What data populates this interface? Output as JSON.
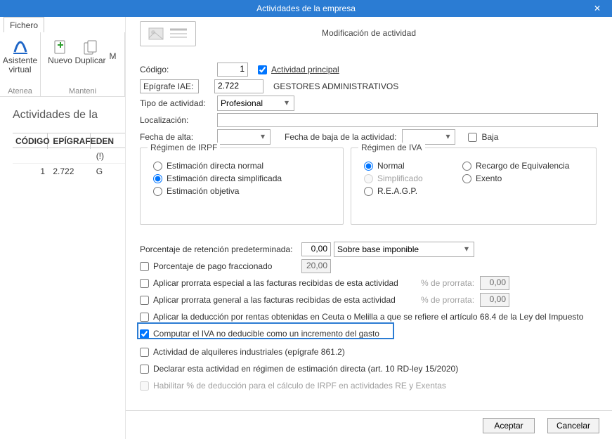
{
  "dialog": {
    "title": "Actividades de la empresa",
    "close": "✕"
  },
  "file_tab": "Fichero",
  "ribbon": {
    "btn_asistente_l1": "Asistente",
    "btn_asistente_l2": "virtual",
    "btn_nuevo": "Nuevo",
    "btn_duplicar": "Duplicar",
    "btn_mod": "M",
    "grp_atenea": "Atenea",
    "grp_mant": "Manteni"
  },
  "grid_title": "Actividades de la",
  "grid": {
    "h1": "CÓDIGO",
    "h2": "EPÍGRAFE",
    "h3": "DEN",
    "r1c1": "1",
    "r1c2": "2.722",
    "r1c3": "(!) G"
  },
  "form_title": "Modificación de actividad",
  "rows": {
    "codigo_lbl": "Código:",
    "codigo_val": "1",
    "principal_lbl": "Actividad principal",
    "epigrafe_lbl": "Epígrafe IAE:",
    "epigrafe_val": "2.722",
    "epigrafe_desc": "GESTORES ADMINISTRATIVOS",
    "tipo_lbl": "Tipo de actividad:",
    "tipo_val": "Profesional",
    "loc_lbl": "Localización:",
    "loc_val": "",
    "alta_lbl": "Fecha de alta:",
    "alta_val": "",
    "baja_lbl": "Fecha de baja de la actividad:",
    "baja_val": "",
    "baja_chk": "Baja"
  },
  "fs_irpf": {
    "legend": "Régimen de IRPF",
    "r1": "Estimación directa normal",
    "r2": "Estimación directa simplificada",
    "r3": "Estimación objetiva"
  },
  "fs_iva": {
    "legend": "Régimen de IVA",
    "r1": "Normal",
    "r2": "Simplificado",
    "r3": "R.E.A.G.P.",
    "r4": "Recargo de Equivalencia",
    "r5": "Exento"
  },
  "block": {
    "ret_lbl": "Porcentaje de retención predeterminada:",
    "ret_val": "0,00",
    "ret_sel": "Sobre base imponible",
    "frac_lbl": "Porcentaje de pago fraccionado",
    "frac_val": "20,00",
    "pro_esp": "Aplicar prorrata especial a las facturas recibidas de esta actividad",
    "pro_gen": "Aplicar prorrata general a las facturas recibidas de esta actividad",
    "pro_pct_lbl": "% de prorrata:",
    "pro_pct_val": "0,00",
    "ceuta": "Aplicar la deducción por rentas obtenidas en Ceuta o Melilla a que se refiere el artículo 68.4 de la Ley del Impuesto",
    "iva_nd": "Computar el IVA no deducible como un incremento del gasto",
    "alq": "Actividad de alquileres industriales (epígrafe 861.2)",
    "rd15": "Declarar esta actividad en régimen de estimación directa (art. 10 RD-ley 15/2020)",
    "hab": "Habilitar % de deducción para el cálculo de IRPF en actividades RE y Exentas"
  },
  "buttons": {
    "ok": "Aceptar",
    "cancel": "Cancelar"
  }
}
